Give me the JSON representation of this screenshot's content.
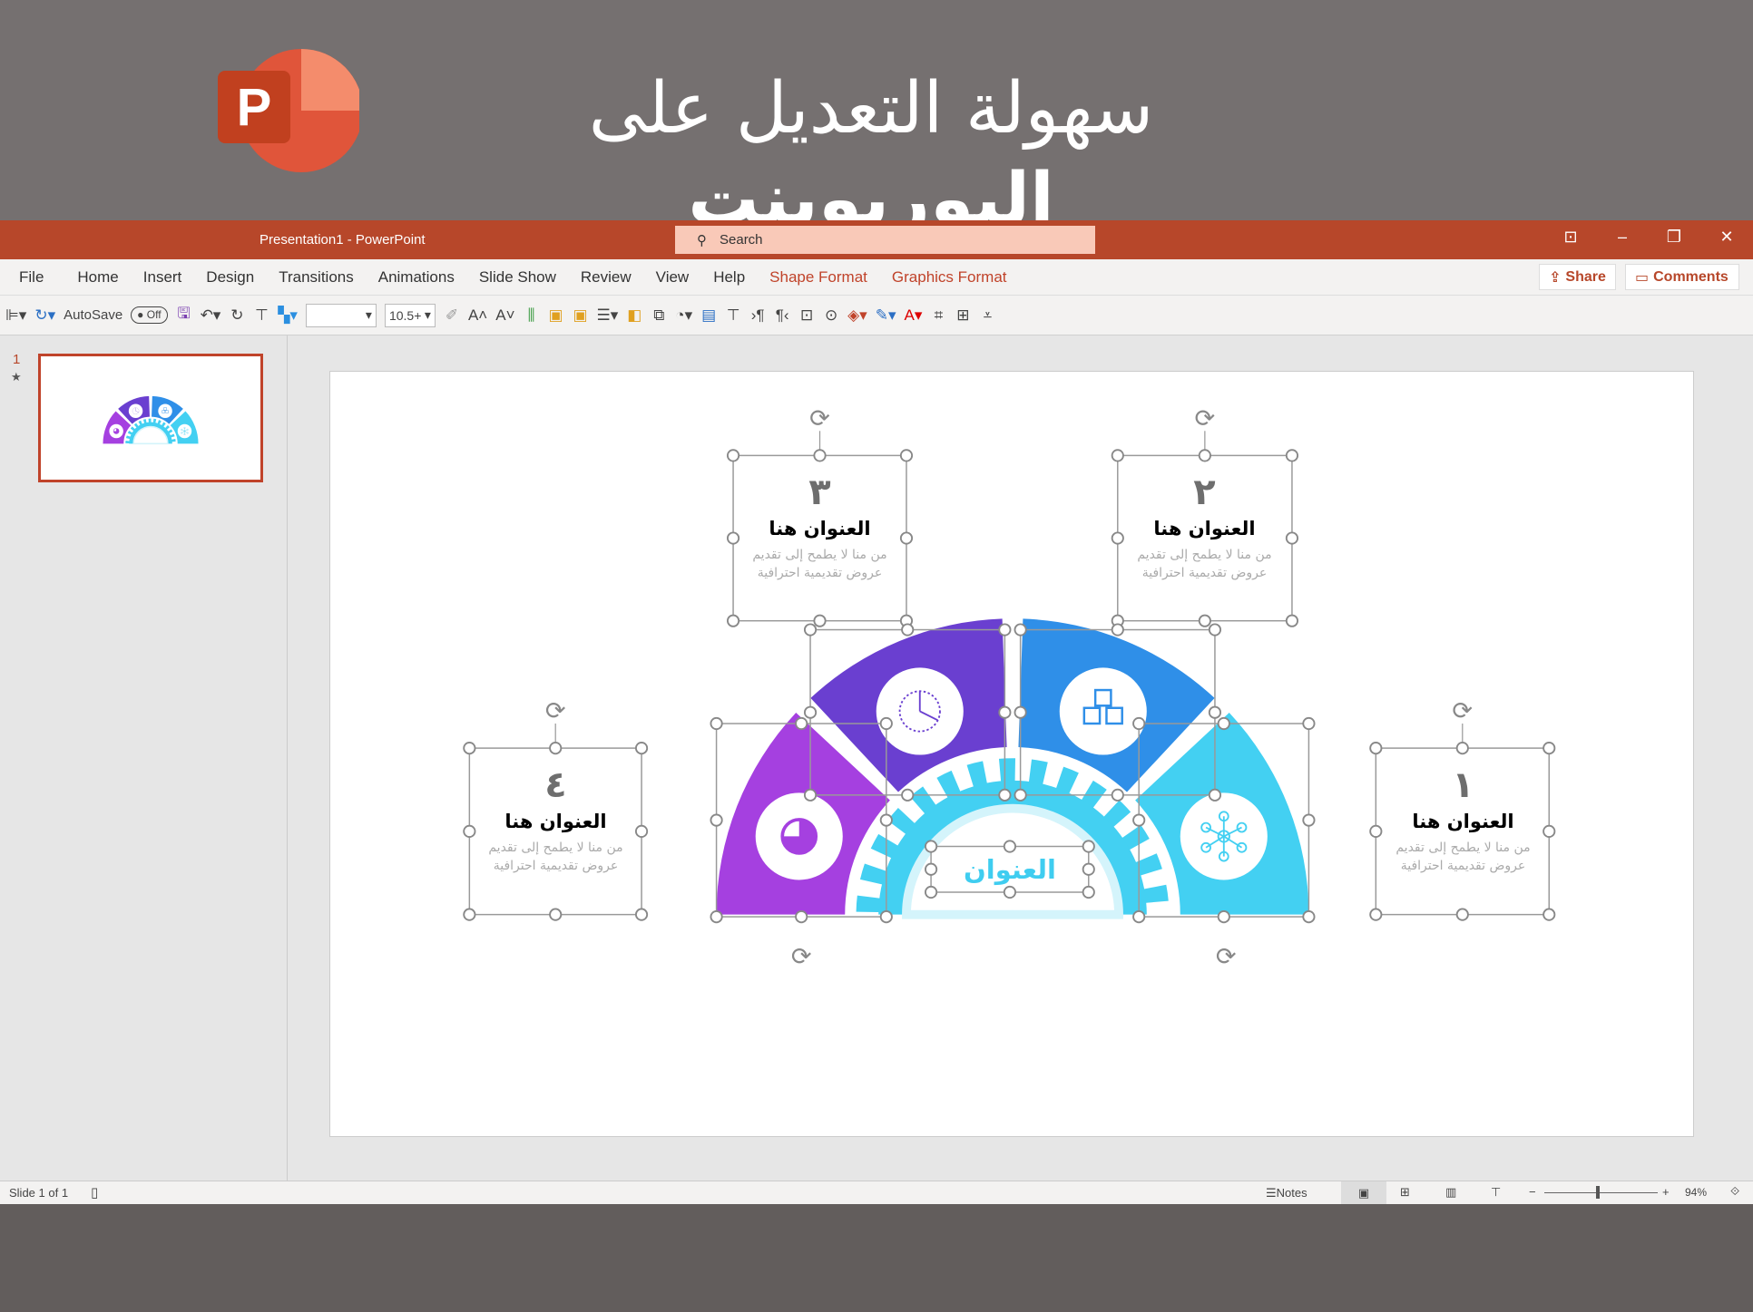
{
  "banner": {
    "title_regular": "سهولة التعديل على",
    "title_bold": "البوربوينت",
    "logo_letter": "P"
  },
  "titlebar": {
    "document": "Presentation1  -  PowerPoint",
    "search_placeholder": "Search",
    "icons": [
      "ribbon-display-icon",
      "minimize-icon",
      "restore-icon",
      "close-icon"
    ]
  },
  "menu": {
    "items": [
      "File",
      "Home",
      "Insert",
      "Design",
      "Transitions",
      "Animations",
      "Slide Show",
      "Review",
      "View",
      "Help"
    ],
    "context_tabs": [
      "Shape Format",
      "Graphics Format"
    ],
    "share": "Share",
    "comments": "Comments"
  },
  "toolbar": {
    "autosave_label": "AutoSave",
    "autosave_state": "Off",
    "font_name": "",
    "font_size": "10.5+"
  },
  "thumbnails": [
    {
      "number": "1",
      "star": "★"
    }
  ],
  "slide": {
    "boxes": [
      {
        "num": "٣",
        "title": "العنوان هنا",
        "body": "من منا لا يطمح إلى تقديم عروض تقديمية احترافية",
        "color": "#6a3fc8"
      },
      {
        "num": "٢",
        "title": "العنوان هنا",
        "body": "من منا لا يطمح إلى تقديم عروض تقديمية احترافية",
        "color": "#2f8fe0"
      },
      {
        "num": "٤",
        "title": "العنوان هنا",
        "body": "من منا لا يطمح إلى تقديم عروض تقديمية احترافية",
        "color": "#a63fd8"
      },
      {
        "num": "١",
        "title": "العنوان هنا",
        "body": "من منا لا يطمح إلى تقديم عروض تقديمية احترافية",
        "color": "#3fcdf0"
      }
    ],
    "center_label": "العنوان",
    "segment_colors": {
      "magenta": "#a540e0",
      "purple": "#6a3fd0",
      "blue": "#2f8fe8",
      "cyan": "#43d0f2"
    }
  },
  "status": {
    "slide_info": "Slide 1 of 1",
    "notes": "Notes",
    "zoom": "94%"
  }
}
